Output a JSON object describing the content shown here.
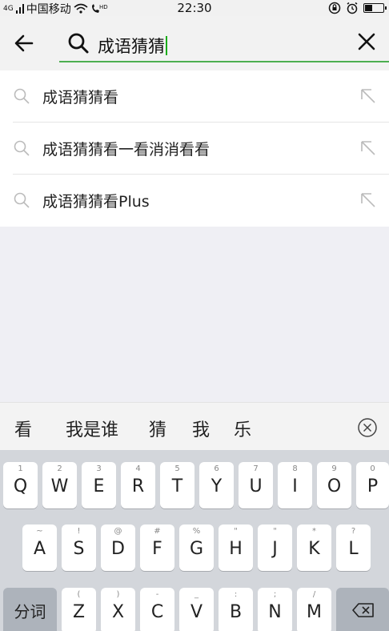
{
  "status_bar": {
    "carrier": "中国移动",
    "network": "4G",
    "time": "22:30"
  },
  "search": {
    "query": "成语猜猜"
  },
  "suggestions": [
    {
      "label": "成语猜猜看"
    },
    {
      "label": "成语猜猜看一看消消看看"
    },
    {
      "label": "成语猜猜看Plus"
    }
  ],
  "candidates": [
    "看",
    "我是谁",
    "猜",
    "我",
    "乐"
  ],
  "keyboard": {
    "row1": [
      {
        "main": "Q",
        "sub": "1"
      },
      {
        "main": "W",
        "sub": "2"
      },
      {
        "main": "E",
        "sub": "3"
      },
      {
        "main": "R",
        "sub": "4"
      },
      {
        "main": "T",
        "sub": "5"
      },
      {
        "main": "Y",
        "sub": "6"
      },
      {
        "main": "U",
        "sub": "7"
      },
      {
        "main": "I",
        "sub": "8"
      },
      {
        "main": "O",
        "sub": "9"
      },
      {
        "main": "P",
        "sub": "0"
      }
    ],
    "row2": [
      {
        "main": "A",
        "sub": "~"
      },
      {
        "main": "S",
        "sub": "!"
      },
      {
        "main": "D",
        "sub": "@"
      },
      {
        "main": "F",
        "sub": "#"
      },
      {
        "main": "G",
        "sub": "%"
      },
      {
        "main": "H",
        "sub": "\""
      },
      {
        "main": "J",
        "sub": "\""
      },
      {
        "main": "K",
        "sub": "*"
      },
      {
        "main": "L",
        "sub": "?"
      }
    ],
    "row3": [
      {
        "main": "Z",
        "sub": "("
      },
      {
        "main": "X",
        "sub": ")"
      },
      {
        "main": "C",
        "sub": "-"
      },
      {
        "main": "V",
        "sub": "_"
      },
      {
        "main": "B",
        "sub": ":"
      },
      {
        "main": "N",
        "sub": ";"
      },
      {
        "main": "M",
        "sub": "/"
      }
    ],
    "fenci_label": "分词"
  },
  "colors": {
    "accent": "#1aad19",
    "underline": "#4caf50"
  }
}
